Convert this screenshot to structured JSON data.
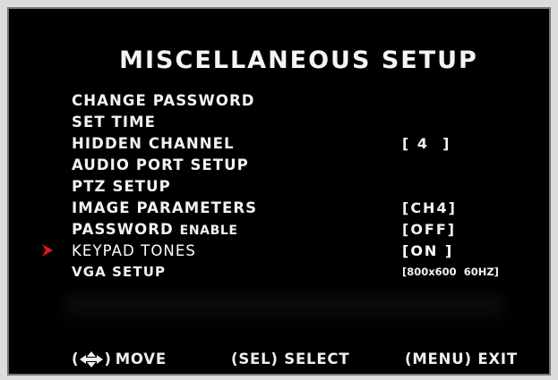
{
  "title": "MISCELLANEOUS SETUP",
  "menu": {
    "items": [
      {
        "label": "CHANGE PASSWORD",
        "value": ""
      },
      {
        "label": "SET TIME",
        "value": ""
      },
      {
        "label": "HIDDEN CHANNEL",
        "value": "[ 4  ]"
      },
      {
        "label": "AUDIO PORT SETUP",
        "value": ""
      },
      {
        "label": "PTZ SETUP",
        "value": ""
      },
      {
        "label": "IMAGE PARAMETERS",
        "value": "[CH4]"
      },
      {
        "label_part1": "PASSWORD",
        "label_part2": "ENABLE",
        "value": "[OFF]"
      },
      {
        "label": "KEYPAD TONES",
        "value": "[ON ]"
      },
      {
        "label": "VGA SETUP",
        "value": "[800x600  60HZ]"
      }
    ],
    "selected_index": 7
  },
  "footer": {
    "move_open": "(",
    "move_close": ")",
    "move_label": "MOVE",
    "select": "(SEL) SELECT",
    "exit": "(MENU) EXIT"
  },
  "colors": {
    "background": "#000000",
    "text": "#f2f2f2",
    "pointer": "#e01818"
  },
  "icons": {
    "pointer": "red-arrow-pointer-icon",
    "move": "four-way-arrow-icon"
  }
}
